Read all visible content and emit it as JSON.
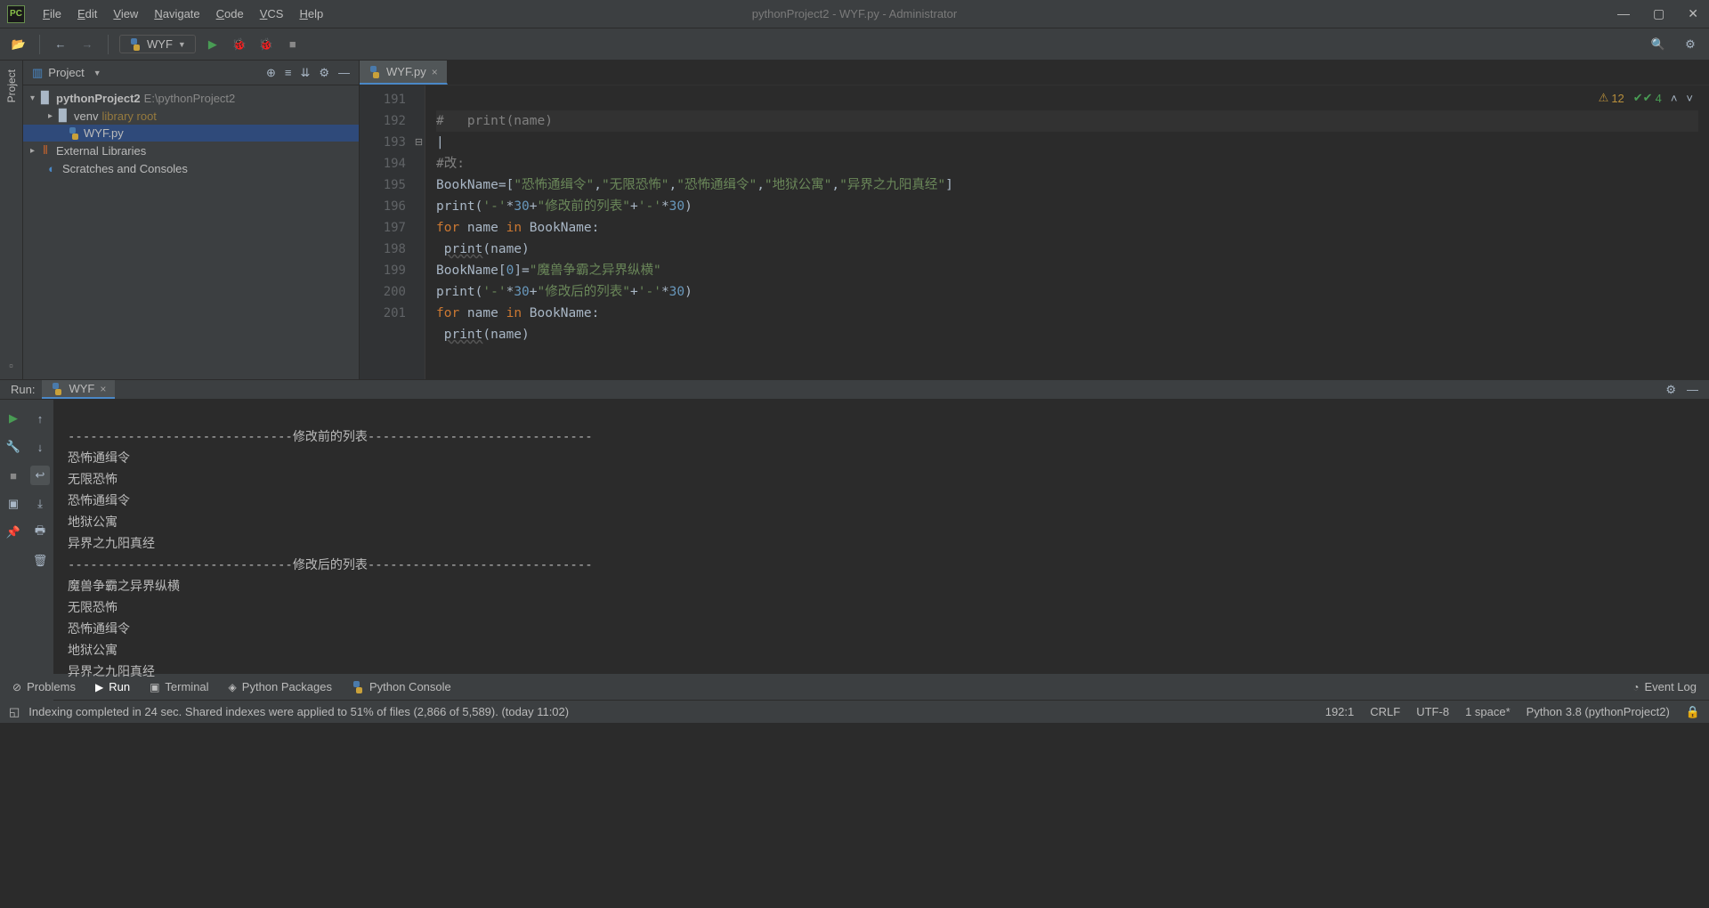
{
  "window_title": "pythonProject2 - WYF.py - Administrator",
  "menubar": [
    "File",
    "Edit",
    "View",
    "Navigate",
    "Code",
    "VCS",
    "Help"
  ],
  "toolbar": {
    "run_config_label": "WYF"
  },
  "project_panel": {
    "title": "Project",
    "root": {
      "name": "pythonProject2",
      "path": "E:\\pythonProject2"
    },
    "venv": {
      "name": "venv",
      "hint": "library root"
    },
    "file": "WYF.py",
    "external_libs": "External Libraries",
    "scratches": "Scratches and Consoles"
  },
  "editor": {
    "tab": "WYF.py",
    "warnings": "12",
    "oks": "4",
    "gutter": [
      "191",
      "192",
      "193",
      "194",
      "195",
      "196",
      "197",
      "198",
      "199",
      "200",
      "201"
    ]
  },
  "code": {
    "l191": "#   print(name)",
    "l193": "#改:",
    "l194_a": "BookName",
    "l194_b": "=[",
    "l194_s1": "\"恐怖通缉令\"",
    "l194_c": ",",
    "l194_s2": "\"无限恐怖\"",
    "l194_s3": "\"恐怖通缉令\"",
    "l194_s4": "\"地狱公寓\"",
    "l194_s5": "\"异界之九阳真经\"",
    "l194_e": "]",
    "l195_a": "print(",
    "l195_b": "'-'",
    "l195_c": "*",
    "l195_d": "30",
    "l195_e": "+",
    "l195_f": "\"修改前的列表\"",
    "l195_g": "+",
    "l195_h": "'-'",
    "l195_i": "*",
    "l195_j": "30",
    "l195_k": ")",
    "l196_a": "for",
    "l196_b": " name ",
    "l196_c": "in",
    "l196_d": " BookName:",
    "l197_a": "print",
    "l197_b": "(name)",
    "l198_a": "BookName[",
    "l198_b": "0",
    "l198_c": "]=",
    "l198_d": "\"魔兽争霸之异界纵横\"",
    "l199_f": "\"修改后的列表\"",
    "l200_a": "for",
    "l200_b": " name ",
    "l200_c": "in",
    "l200_d": " BookName:",
    "l201_a": "print",
    "l201_b": "(name)"
  },
  "run_panel": {
    "title": "Run:",
    "tab": "WYF"
  },
  "output_lines": [
    "------------------------------修改前的列表------------------------------",
    "恐怖通缉令",
    "无限恐怖",
    "恐怖通缉令",
    "地狱公寓",
    "异界之九阳真经",
    "------------------------------修改后的列表------------------------------",
    "魔兽争霸之异界纵横",
    "无限恐怖",
    "恐怖通缉令",
    "地狱公寓",
    "异界之九阳真经"
  ],
  "bottom_tools": {
    "problems": "Problems",
    "run": "Run",
    "terminal": "Terminal",
    "python_packages": "Python Packages",
    "python_console": "Python Console",
    "event_log": "Event Log"
  },
  "statusbar": {
    "message": "Indexing completed in 24 sec. Shared indexes were applied to 51% of files (2,866 of 5,589). (today 11:02)",
    "caret": "192:1",
    "eol": "CRLF",
    "encoding": "UTF-8",
    "indent": "1 space*",
    "interpreter": "Python 3.8 (pythonProject2)"
  }
}
